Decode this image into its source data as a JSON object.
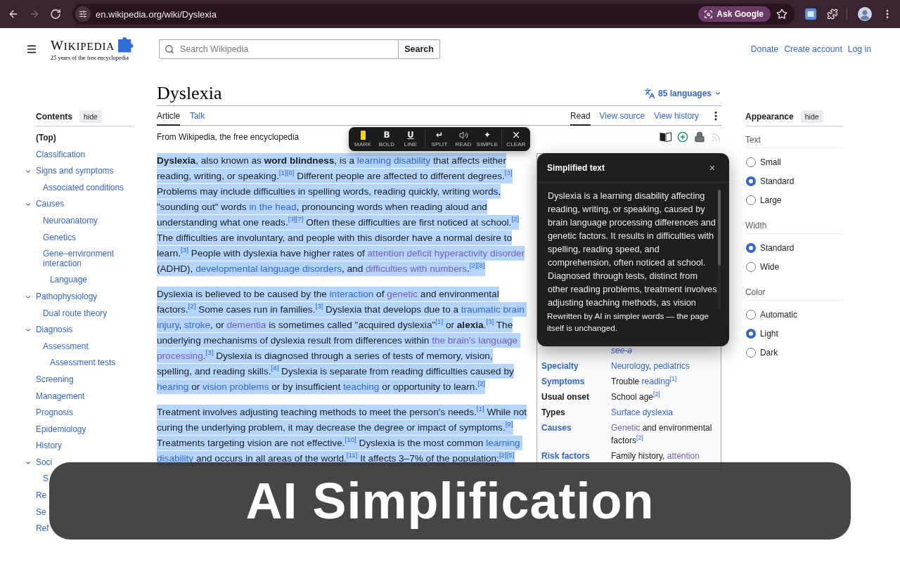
{
  "browser": {
    "nav_buttons": [
      {
        "kind": "back",
        "disabled": false
      },
      {
        "kind": "forward",
        "disabled": true
      },
      {
        "kind": "reload",
        "disabled": false
      }
    ],
    "url": "en.wikipedia.org/wiki/Dyslexia",
    "ask_button": "Ask Google"
  },
  "header": {
    "wordmark": "WIKIPEDIA",
    "tagline": "25 years of the free encyclopedia",
    "search": {
      "placeholder": "Search Wikipedia",
      "button": "Search"
    },
    "user_links": [
      "Donate",
      "Create account",
      "Log in"
    ]
  },
  "toc": {
    "title": "Contents",
    "hide_button": "hide",
    "items": [
      {
        "label": "(Top)",
        "selected": true,
        "expanded": false
      },
      {
        "label": "Classification",
        "selected": false,
        "expanded": false
      },
      {
        "label": "Signs and symptoms",
        "selected": false,
        "expanded": true,
        "children": [
          {
            "label": "Associated conditions",
            "selected": false
          }
        ]
      },
      {
        "label": "Causes",
        "selected": false,
        "expanded": true,
        "children": [
          {
            "label": "Neuroanatomy",
            "selected": false
          },
          {
            "label": "Genetics",
            "selected": false
          },
          {
            "label": "Gene–environment interaction",
            "selected": false,
            "children": [
              {
                "label": "Language",
                "selected": false
              }
            ]
          }
        ]
      },
      {
        "label": "Pathophysiology",
        "selected": false,
        "expanded": true,
        "children": [
          {
            "label": "Dual route theory",
            "selected": false
          }
        ]
      },
      {
        "label": "Diagnosis",
        "selected": false,
        "expanded": true,
        "children": [
          {
            "label": "Assessment",
            "selected": false,
            "children": [
              {
                "label": "Assessment tests",
                "selected": false
              }
            ]
          }
        ]
      },
      {
        "label": "Screening",
        "selected": false,
        "expanded": false
      },
      {
        "label": "Management",
        "selected": false,
        "expanded": false
      },
      {
        "label": "Prognosis",
        "selected": false,
        "expanded": false
      },
      {
        "label": "Epidemiology",
        "selected": false,
        "expanded": false
      },
      {
        "label": "History",
        "selected": false,
        "expanded": false
      },
      {
        "label": "Soci",
        "selected": false,
        "expanded": true,
        "children": [
          {
            "label": "S",
            "selected": false
          }
        ]
      },
      {
        "label": "Re",
        "selected": false,
        "expanded": false
      },
      {
        "label": "Se",
        "selected": false,
        "expanded": false
      },
      {
        "label": "Ref",
        "selected": false,
        "expanded": false
      }
    ]
  },
  "article": {
    "title": "Dyslexia",
    "languages": "85 languages",
    "namespace_tabs": [
      {
        "label": "Article",
        "selected": true
      },
      {
        "label": "Talk",
        "selected": false
      }
    ],
    "view_tabs": [
      {
        "label": "Read",
        "selected": true
      },
      {
        "label": "View source",
        "selected": false
      },
      {
        "label": "View history",
        "selected": false
      }
    ],
    "site_sub": "From Wikipedia, the free encyclopedia",
    "paragraphs": [
      {
        "selected": true,
        "segments": [
          {
            "text": "**Dyslexia**, also known as **word blindness**, is a "
          },
          {
            "link": "learning disability",
            "visited": false
          },
          {
            "text": " that affects either reading, writing, or speaking.$^{[1][6]}$ Different people are affected to different degrees.$^{[3]}$ Problems may include difficulties in spelling words, reading quickly, writing words, \"sounding out\" words "
          },
          {
            "link": "in the head",
            "visited": false
          },
          {
            "text": ", pronouncing words when reading aloud and understanding what one reads.$^{[3][7]}$ Often these difficulties are first noticed at school.$^{[2]}$ The difficulties are involuntary, and people with this disorder have a normal desire to learn.$^{[3]}$ People with dyslexia have higher rates of "
          },
          {
            "link": "attention deficit hyperactivity disorder",
            "visited": true
          },
          {
            "text": " (ADHD), "
          },
          {
            "link": "developmental language disorders",
            "visited": false
          },
          {
            "text": ", and "
          },
          {
            "link": "difficulties with numbers",
            "visited": true
          },
          {
            "text": ".$^{[2][8]}$"
          }
        ]
      },
      {
        "selected": true,
        "segments": [
          {
            "text": "Dyslexia is believed to be caused by the "
          },
          {
            "link": "interaction",
            "visited": false
          },
          {
            "text": " of "
          },
          {
            "link": "genetic",
            "visited": true
          },
          {
            "text": " and environmental factors.$^{[2]}$ Some cases run in families.$^{[3]}$ Dyslexia that develops due to a "
          },
          {
            "link": "traumatic brain",
            "visited": false
          },
          {
            "link": "injury",
            "visited": false
          },
          {
            "text": ", "
          },
          {
            "link": "stroke",
            "visited": false
          },
          {
            "text": ", or "
          },
          {
            "link": "dementia",
            "visited": true
          },
          {
            "text": " is sometimes called \"acquired dyslexia\"$^{[1]}$ or **alexia**.$^{[3]}$ The underlying mechanisms of dyslexia result from differences within "
          },
          {
            "link": "the brain's language",
            "visited": true
          },
          {
            "link": "processing",
            "visited": true
          },
          {
            "text": ".$^{[3]}$ Dyslexia is diagnosed through a series of tests of memory, vision, spelling, and reading skills.$^{[4]}$ Dyslexia is separate from reading difficulties caused by "
          },
          {
            "link": "hearing",
            "visited": false
          },
          {
            "text": " or "
          },
          {
            "link": "vision problems",
            "visited": false
          },
          {
            "text": " or by insufficient "
          },
          {
            "link": "teaching",
            "visited": false
          },
          {
            "text": " or opportunity to learn.$^{[2]}$"
          }
        ]
      },
      {
        "selected": true,
        "segments": [
          {
            "text": "Treatment involves adjusting teaching methods to meet the person's needs.$^{[1]}$ While not curing the underlying problem, it may decrease the degree or impact of symptoms.$^{[9]}$ Treatments targeting vision are not effective.$^{[10]}$ Dyslexia is the most common "
          },
          {
            "link": "learning",
            "visited": false
          },
          {
            "link": "disability",
            "visited": false
          },
          {
            "text": " and occurs in all areas of the world.$^{[11]}$ It affects 3–7% of the population;$^{[2][5]}$"
          }
        ]
      }
    ]
  },
  "selection_toolbar": {
    "groups": [
      [
        {
          "kind": "mark",
          "label": "MARK"
        },
        {
          "kind": "bold",
          "glyph": "B",
          "label": "BOLD"
        },
        {
          "kind": "underline",
          "glyph": "U",
          "label": "LINE"
        }
      ],
      [
        {
          "kind": "split",
          "glyph": "↵",
          "label": "SPLIT"
        },
        {
          "kind": "read",
          "label": "READ"
        },
        {
          "kind": "simplify",
          "glyph": "✦",
          "label": "SIMPLE"
        }
      ],
      [
        {
          "kind": "clear",
          "glyph": "×",
          "label": "CLEAR"
        }
      ]
    ]
  },
  "simplify_popup": {
    "title": "Simplified text",
    "close": "×",
    "body": "Dyslexia is a learning disability affecting reading, writing, or speaking, caused by brain language processing differences and genetic factors. It results in difficulties with spelling, reading speed, and comprehension, often noticed at school. Diagnosed through tests, distinct from other reading problems, treatment involves adjusting teaching methods, as vision",
    "note": "Rewritten by AI in simpler words — the page itself is unchanged."
  },
  "infobox": {
    "respelling": "see-ə",
    "rows": [
      {
        "label": "Specialty",
        "linked": true,
        "value": [
          {
            "link": "Neurology",
            "visited": false
          },
          {
            "text": ", "
          },
          {
            "link": "pediatrics",
            "visited": false
          }
        ]
      },
      {
        "label": "Symptoms",
        "linked": true,
        "value": [
          {
            "text": "Trouble "
          },
          {
            "link": "reading",
            "visited": false
          },
          {
            "text": "$^{[1]}$"
          }
        ]
      },
      {
        "label": "Usual onset",
        "linked": false,
        "value": [
          {
            "text": "School age$^{[2]}$"
          }
        ]
      },
      {
        "label": "Types",
        "linked": false,
        "value": [
          {
            "link": "Surface dyslexia",
            "visited": false
          }
        ]
      },
      {
        "label": "Causes",
        "linked": true,
        "value": [
          {
            "link": "Genetic",
            "visited": true
          },
          {
            "text": " and environmental factors$^{[2]}$"
          }
        ]
      },
      {
        "label": "Risk factors",
        "linked": true,
        "value": [
          {
            "text": "Family history, "
          },
          {
            "link": "attention",
            "visited": true
          }
        ]
      }
    ]
  },
  "appearance": {
    "title": "Appearance",
    "hide_button": "hide",
    "sections": [
      {
        "heading": "Text",
        "options": [
          {
            "label": "Small",
            "selected": false
          },
          {
            "label": "Standard",
            "selected": true
          },
          {
            "label": "Large",
            "selected": false
          }
        ]
      },
      {
        "heading": "Width",
        "options": [
          {
            "label": "Standard",
            "selected": true
          },
          {
            "label": "Wide",
            "selected": false
          }
        ]
      },
      {
        "heading": "Color",
        "options": [
          {
            "label": "Automatic",
            "selected": false
          },
          {
            "label": "Light",
            "selected": true
          },
          {
            "label": "Dark",
            "selected": false
          }
        ]
      }
    ]
  },
  "caption": "AI Simplification"
}
